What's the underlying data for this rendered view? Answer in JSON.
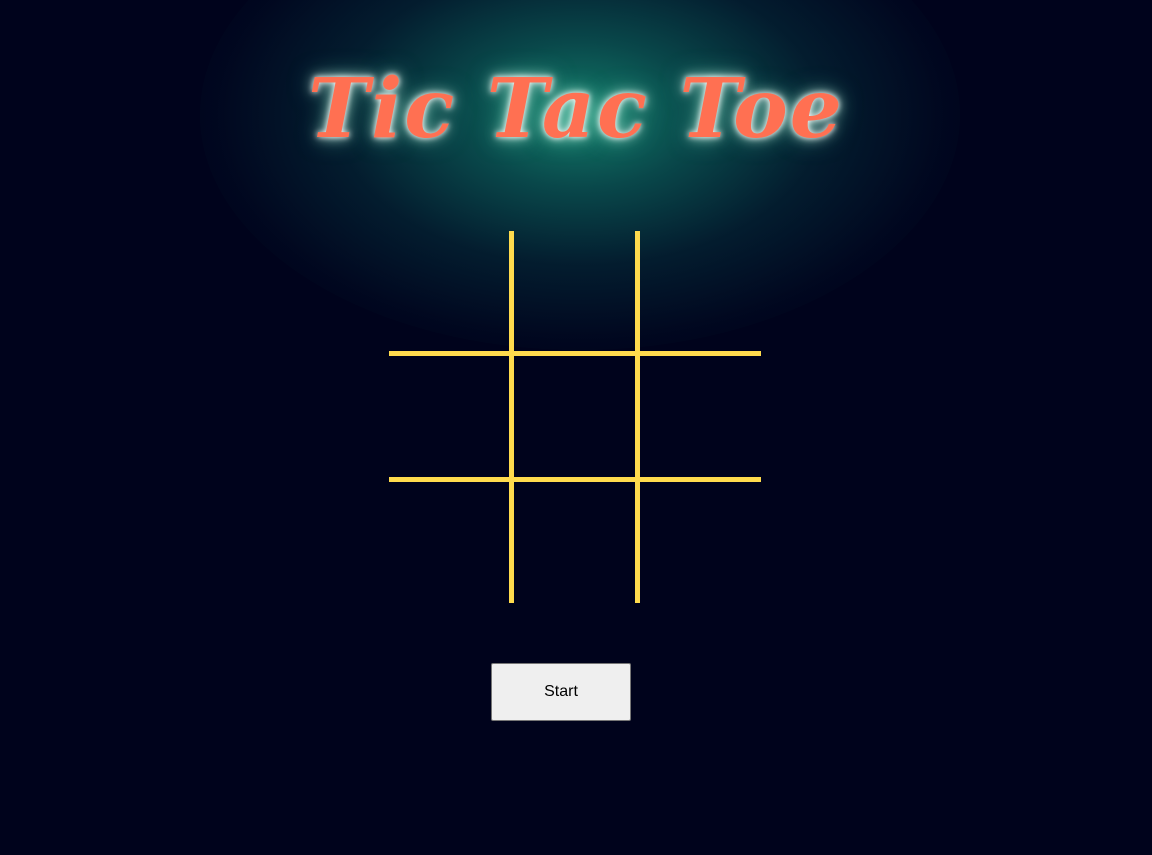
{
  "title": "Tic Tac Toe",
  "board": {
    "cells": [
      "",
      "",
      "",
      "",
      "",
      "",
      "",
      "",
      ""
    ],
    "line_color": "#ffdb4d"
  },
  "start_button": {
    "label": "Start"
  },
  "colors": {
    "background": "#00031c",
    "title": "#ff7052",
    "glow": "#14826e"
  }
}
